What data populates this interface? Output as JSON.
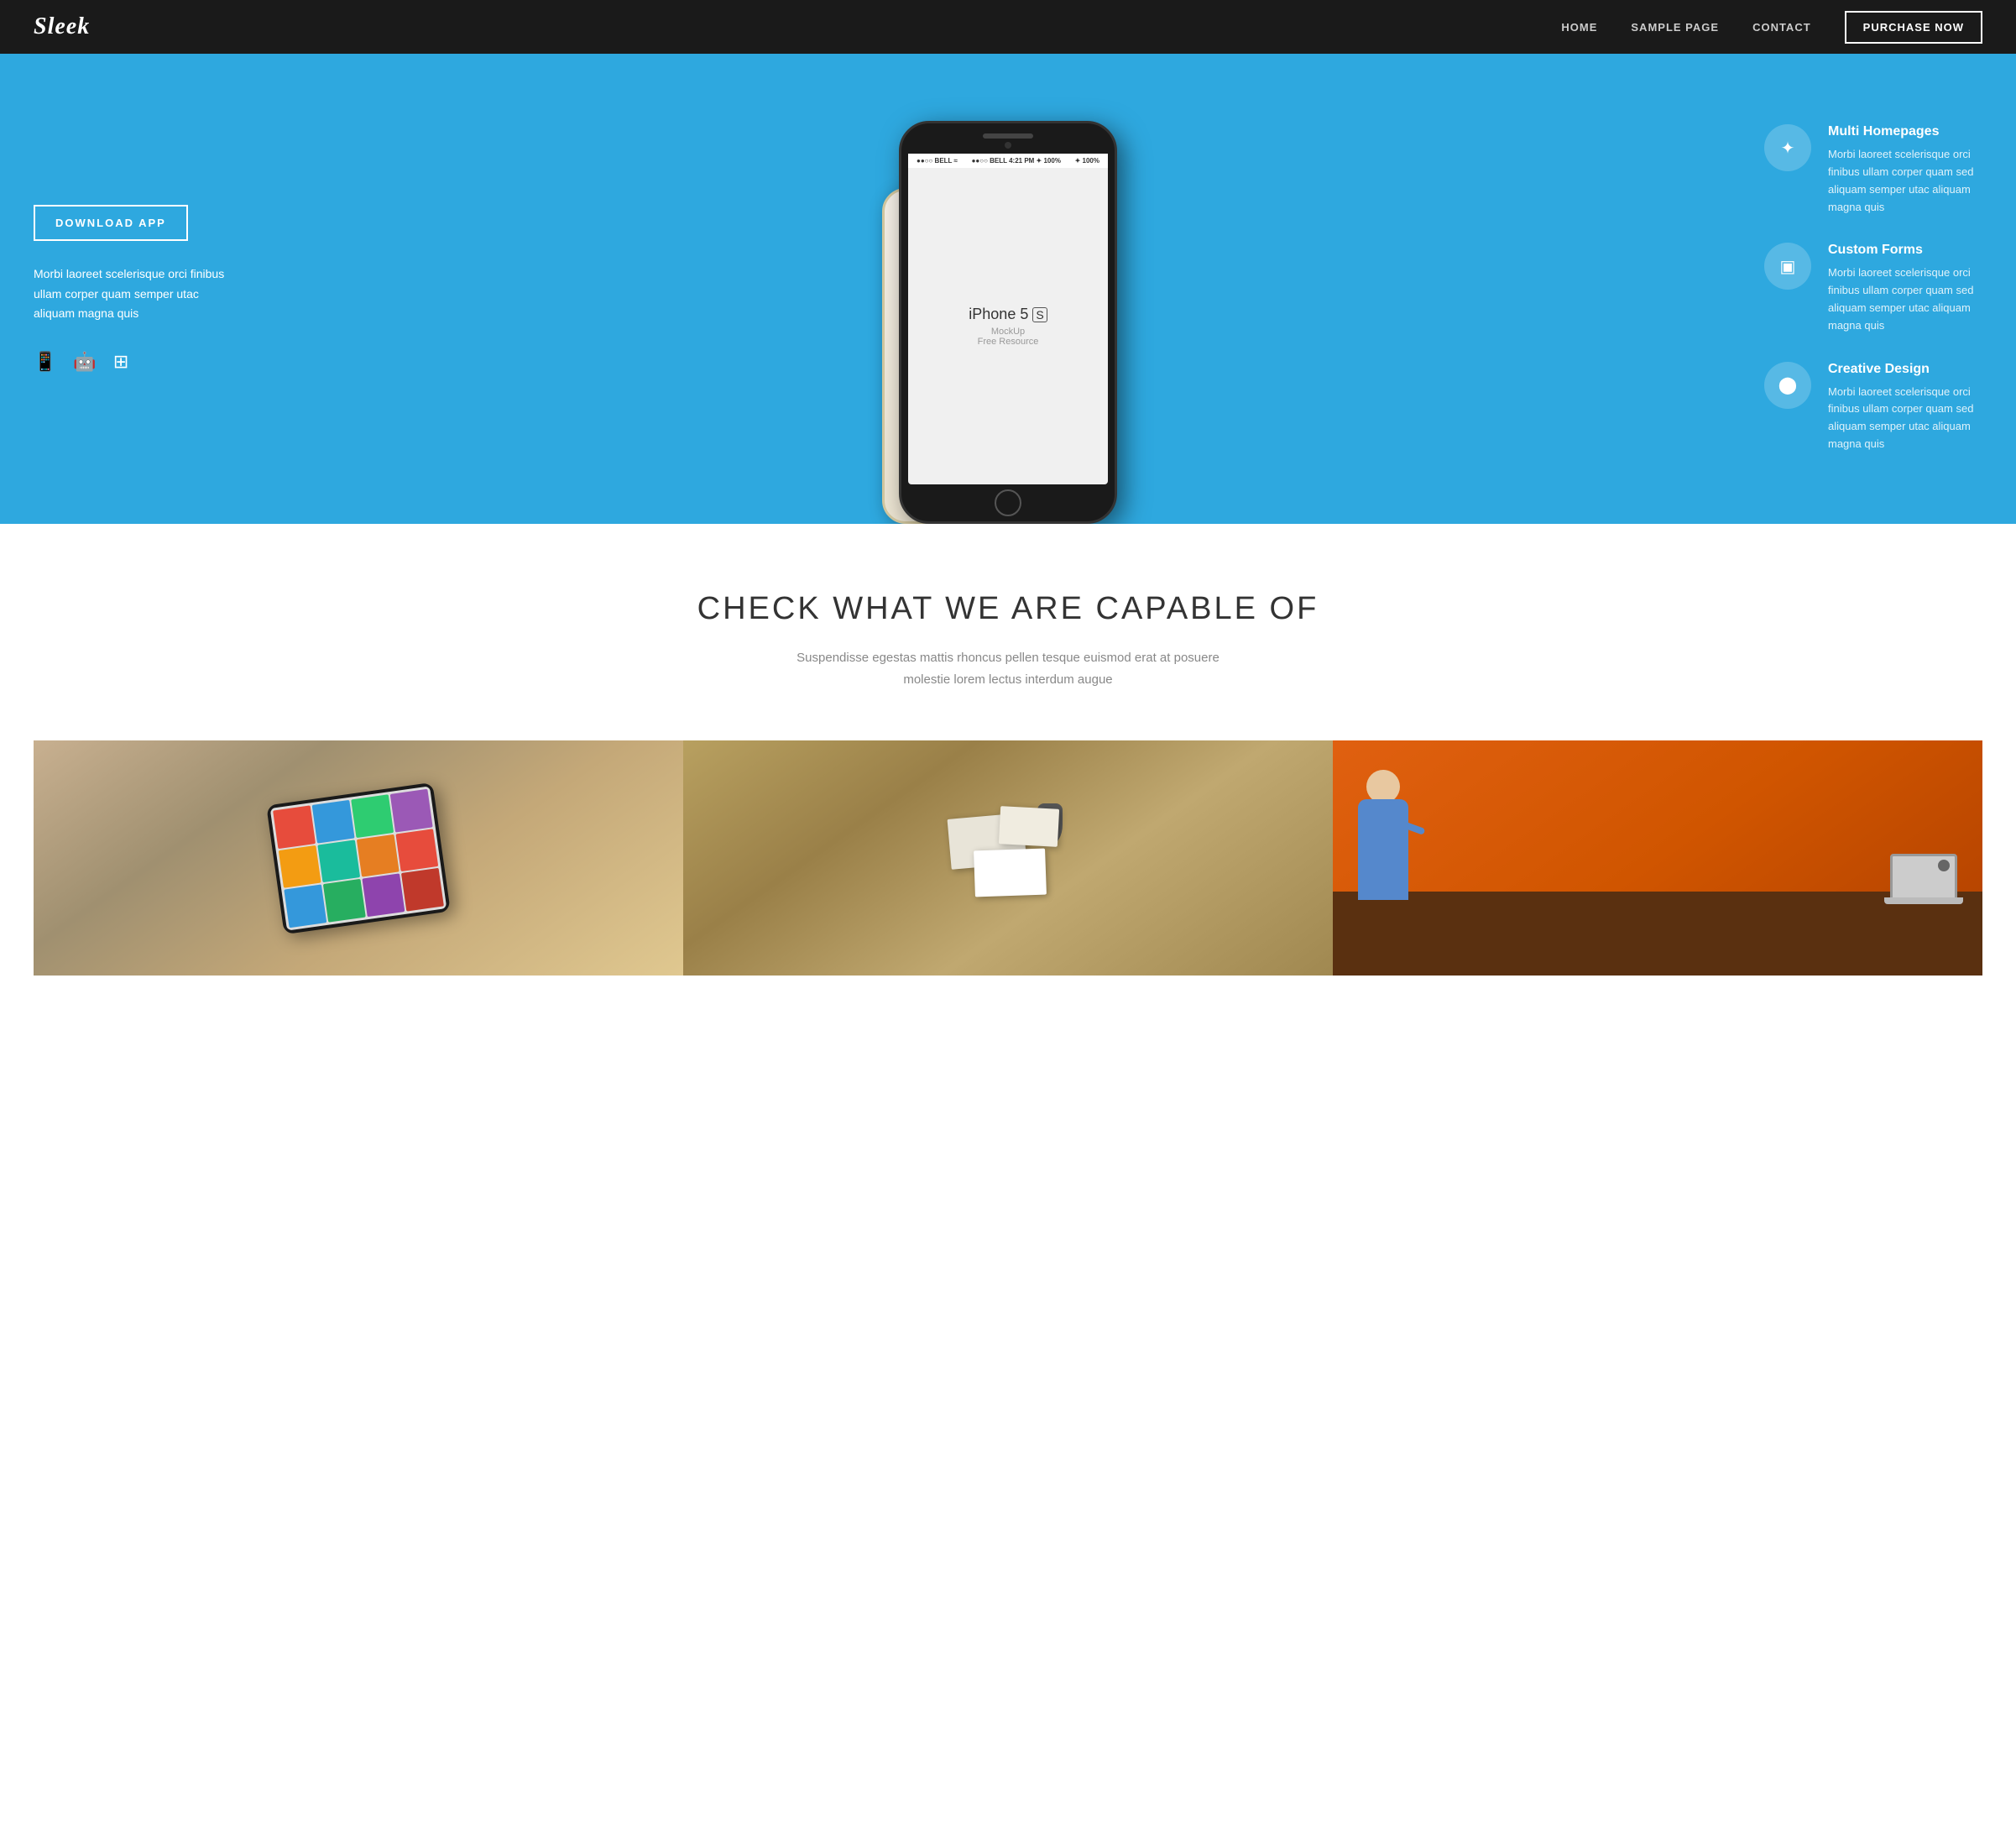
{
  "navbar": {
    "logo": "Sleek",
    "links": [
      {
        "id": "home",
        "label": "HOME"
      },
      {
        "id": "sample-page",
        "label": "SAMPLE PAGE"
      },
      {
        "id": "contact",
        "label": "CONTACT"
      }
    ],
    "cta_label": "PURCHASE NOW"
  },
  "hero": {
    "download_btn": "DOWNLOAD APP",
    "description": "Morbi laoreet scelerisque orci finibus ullam corper quam semper utac aliquam magna quis",
    "platforms": [
      "iOS",
      "Android",
      "Windows"
    ],
    "features": [
      {
        "id": "multi-homepages",
        "icon": "✦",
        "title": "Multi Homepages",
        "description": "Morbi laoreet scelerisque orci finibus ullam corper quam sed aliquam semper utac aliquam magna quis"
      },
      {
        "id": "custom-forms",
        "icon": "▣",
        "title": "Custom Forms",
        "description": "Morbi laoreet scelerisque orci finibus ullam corper quam sed aliquam semper utac aliquam magna quis"
      },
      {
        "id": "creative-design",
        "icon": "◉",
        "title": "Creative Design",
        "description": "Morbi laoreet scelerisque orci finibus ullam corper quam sed aliquam semper utac aliquam magna quis"
      }
    ],
    "phone": {
      "status_bar": "●●○○ BELL  4:21 PM  ✦ 100%",
      "model": "iPhone 5",
      "model_suffix": "S",
      "mockup_label": "MockUp",
      "free_label": "Free Resource"
    }
  },
  "capabilities": {
    "heading": "CHECK WHAT WE ARE CAPABLE OF",
    "subtext": "Suspendisse egestas mattis rhoncus pellen tesque euismod erat at posuere molestie lorem lectus interdum augue"
  },
  "portfolio": {
    "items": [
      {
        "id": "tablet-showcase",
        "alt": "Tablet app showcase"
      },
      {
        "id": "stationery",
        "alt": "Branding stationery"
      },
      {
        "id": "office",
        "alt": "Office workspace"
      }
    ]
  }
}
